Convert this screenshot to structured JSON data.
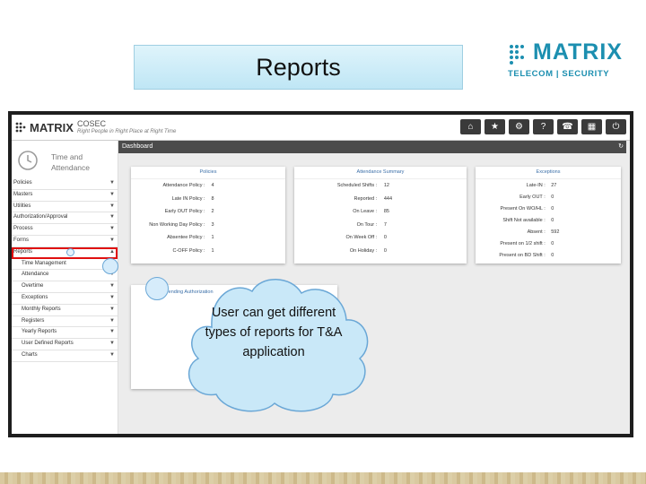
{
  "slide_title": "Reports",
  "logo": {
    "word": "MATRIX",
    "sub": "TELECOM | SECURITY",
    "color": "#1c8fb0"
  },
  "app": {
    "brand": "MATRIX",
    "product": "COSEC",
    "tagline": "Right People in Right Place at Right Time",
    "toolbar_icons": [
      "home-icon",
      "star-icon",
      "gear-icon",
      "help-icon",
      "phone-icon",
      "building-icon",
      "power-icon"
    ]
  },
  "sidebar": {
    "module_line1": "Time and",
    "module_line2": "Attendance",
    "items": [
      {
        "label": "Policies",
        "sub": false,
        "arrow": "▼"
      },
      {
        "label": "Masters",
        "sub": false,
        "arrow": "▼"
      },
      {
        "label": "Utilities",
        "sub": false,
        "arrow": "▼"
      },
      {
        "label": "Authorization/Approval",
        "sub": false,
        "arrow": "▼"
      },
      {
        "label": "Process",
        "sub": false,
        "arrow": "▼"
      },
      {
        "label": "Forms",
        "sub": false,
        "arrow": "▼"
      },
      {
        "label": "Reports",
        "sub": false,
        "arrow": "▲",
        "selected": true
      },
      {
        "label": "Time Management",
        "sub": true,
        "arrow": ""
      },
      {
        "label": "Attendance",
        "sub": true,
        "arrow": "▼"
      },
      {
        "label": "Overtime",
        "sub": true,
        "arrow": "▼"
      },
      {
        "label": "Exceptions",
        "sub": true,
        "arrow": "▼"
      },
      {
        "label": "Monthly Reports",
        "sub": true,
        "arrow": "▼"
      },
      {
        "label": "Registers",
        "sub": true,
        "arrow": "▼"
      },
      {
        "label": "Yearly Reports",
        "sub": true,
        "arrow": "▼"
      },
      {
        "label": "User Defined Reports",
        "sub": true,
        "arrow": "▼"
      },
      {
        "label": "Charts",
        "sub": true,
        "arrow": "▼"
      }
    ]
  },
  "dashboard": {
    "title": "Dashboard",
    "panels": [
      {
        "title": "Policies",
        "rows": [
          {
            "label": "Attendance Policy :",
            "value": "4"
          },
          {
            "label": "Late IN Policy :",
            "value": "8"
          },
          {
            "label": "Early OUT Policy :",
            "value": "2"
          },
          {
            "label": "Non Working Day Policy :",
            "value": "3"
          },
          {
            "label": "Absentee Policy :",
            "value": "1"
          },
          {
            "label": "C-OFF Policy :",
            "value": "1"
          }
        ]
      },
      {
        "title": "Attendance Summary",
        "rows": [
          {
            "label": "Scheduled Shifts :",
            "value": "12"
          },
          {
            "label": "Reported :",
            "value": "444"
          },
          {
            "label": "On Leave :",
            "value": "85"
          },
          {
            "label": "On Tour :",
            "value": "7"
          },
          {
            "label": "On Week Off :",
            "value": "0"
          },
          {
            "label": "On Holiday :",
            "value": "0"
          }
        ]
      },
      {
        "title": "Exceptions",
        "rows": [
          {
            "label": "Late-IN :",
            "value": "27"
          },
          {
            "label": "Early OUT :",
            "value": "0"
          },
          {
            "label": "Present On WO/HL :",
            "value": "0"
          },
          {
            "label": "Shift Not available :",
            "value": "0"
          },
          {
            "label": "Absent :",
            "value": "592"
          },
          {
            "label": "Present on 1/2 shift :",
            "value": "0"
          },
          {
            "label": "Present on BD Shift :",
            "value": "0"
          }
        ]
      }
    ],
    "pending_title": "Pending Authorization"
  },
  "callout": "User can get different types of reports for T&A application"
}
